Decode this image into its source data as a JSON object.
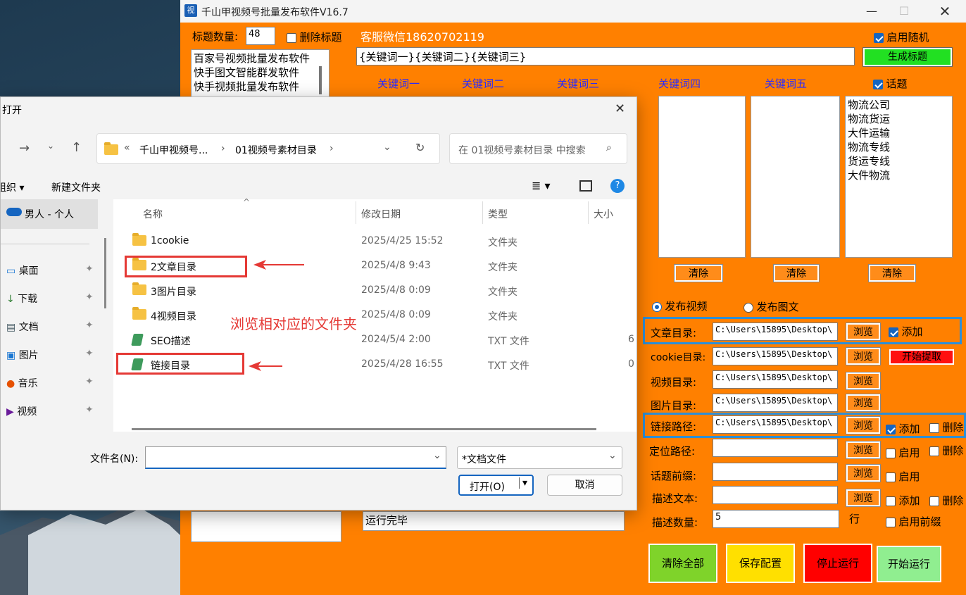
{
  "app": {
    "title": "千山甲视频号批量发布软件V16.7",
    "icon_text": "视",
    "title_count_label": "标题数量:",
    "title_count_value": "48",
    "delete_title_label": "删除标题",
    "service_text": "客服微信18620702119",
    "enable_random_label": "启用随机",
    "keyword_template": "{关键词一}{关键词二}{关键词三}",
    "generate_title_button": "生成标题",
    "title_list": [
      "百家号视频批量发布软件",
      "快手图文智能群发软件",
      "快手视频批量发布软件"
    ],
    "keyword_headers": [
      "关键词一",
      "关键词二",
      "关键词三",
      "关键词四",
      "关键词五"
    ],
    "topic_label": "话题",
    "topic_list": [
      "物流公司",
      "物流货运",
      "大件运输",
      "物流专线",
      "货运专线",
      "大件物流"
    ],
    "clear_label": "清除",
    "publish_video_label": "发布视频",
    "publish_image_label": "发布图文",
    "rows": {
      "article_dir": {
        "label": "文章目录:",
        "value": "C:\\Users\\15895\\Desktop\\"
      },
      "cookie_dir": {
        "label": "cookie目录:",
        "value": "C:\\Users\\15895\\Desktop\\"
      },
      "video_dir": {
        "label": "视频目录:",
        "value": "C:\\Users\\15895\\Desktop\\"
      },
      "image_dir": {
        "label": "图片目录:",
        "value": "C:\\Users\\15895\\Desktop\\"
      },
      "link_path": {
        "label": "链接路径:",
        "value": "C:\\Users\\15895\\Desktop\\"
      },
      "location_path": {
        "label": "定位路径:",
        "value": ""
      },
      "topic_prefix": {
        "label": "话题前缀:",
        "value": ""
      },
      "desc_text": {
        "label": "描述文本:",
        "value": ""
      },
      "desc_count": {
        "label": "描述数量:",
        "value": "5"
      }
    },
    "browse_label": "浏览",
    "add_label": "添加",
    "delete_label": "删除",
    "enable_label": "启用",
    "start_extract_button": "开始提取",
    "row_suffix": "行",
    "enable_prefix_label": "启用前缀",
    "log_text": "运行完毕",
    "buttons": {
      "clear_all": "清除全部",
      "save_config": "保存配置",
      "stop_run": "停止运行",
      "start_run": "开始运行"
    }
  },
  "dialog": {
    "title": "打开",
    "breadcrumb": [
      "千山甲视频号...",
      "01视频号素材目录"
    ],
    "breadcrumb_prefix": "«",
    "search_placeholder": "在 01视频号素材目录 中搜索",
    "organize_label": "组织 ▾",
    "new_folder_label": "新建文件夹",
    "columns": [
      "名称",
      "修改日期",
      "类型",
      "大小"
    ],
    "files": [
      {
        "name": "1cookie",
        "date": "2025/4/25 15:52",
        "type": "文件夹",
        "size": "",
        "icon": "folder-icon"
      },
      {
        "name": "2文章目录",
        "date": "2025/4/8 9:43",
        "type": "文件夹",
        "size": "",
        "icon": "folder-icon"
      },
      {
        "name": "3图片目录",
        "date": "2025/4/8 0:09",
        "type": "文件夹",
        "size": "",
        "icon": "folder-icon"
      },
      {
        "name": "4视频目录",
        "date": "2025/4/8 0:09",
        "type": "文件夹",
        "size": "",
        "icon": "folder-icon"
      },
      {
        "name": "SEO描述",
        "date": "2024/5/4 2:00",
        "type": "TXT 文件",
        "size": "6",
        "icon": "text-file-icon"
      },
      {
        "name": "链接目录",
        "date": "2025/4/28 16:55",
        "type": "TXT 文件",
        "size": "0",
        "icon": "text-file-icon"
      }
    ],
    "sidebar": [
      "男人 - 个人",
      "桌面",
      "下载",
      "文档",
      "图片",
      "音乐",
      "视频"
    ],
    "annotation": "浏览相对应的文件夹",
    "filename_label": "文件名(N):",
    "filename_value": "",
    "filetype_value": "*文档文件",
    "open_button": "打开(O)",
    "cancel_button": "取消"
  }
}
